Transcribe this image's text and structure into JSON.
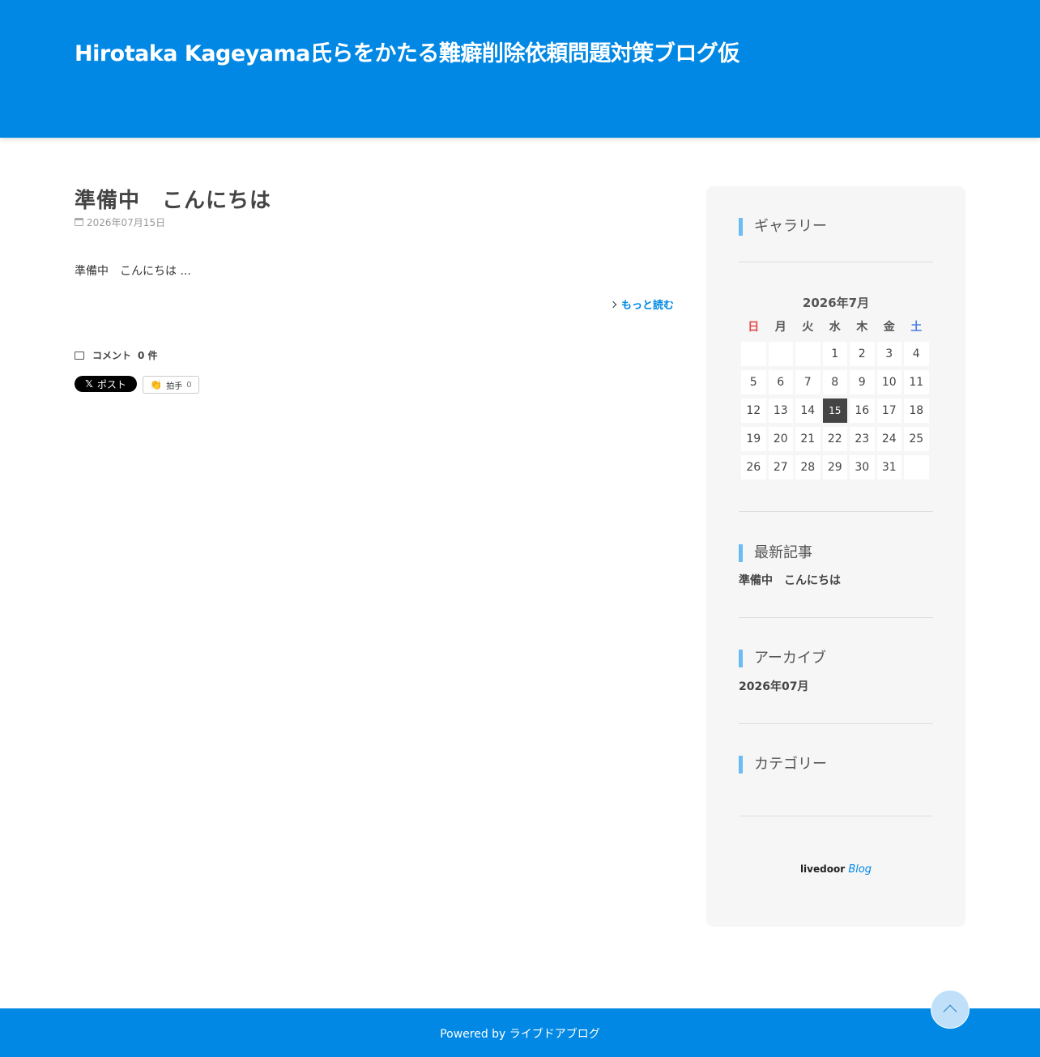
{
  "header": {
    "site_title": "Hirotaka Kageyama氏らをかたる難癖削除依頼問題対策ブログ仮"
  },
  "article": {
    "title": "準備中　こんにちは",
    "date": "2026年07月15日",
    "excerpt": "準備中　こんにちは ...",
    "read_more": "もっと読む",
    "comments_label": "コメント",
    "comments_count": "0 件",
    "x_post_label": "ポスト",
    "clap_label": "拍手",
    "clap_count": "0"
  },
  "sidebar": {
    "gallery_title": "ギャラリー",
    "calendar": {
      "caption": "2026年7月",
      "weekdays": [
        "日",
        "月",
        "火",
        "水",
        "木",
        "金",
        "土"
      ],
      "weeks": [
        [
          "",
          "",
          "",
          "1",
          "2",
          "3",
          "4"
        ],
        [
          "5",
          "6",
          "7",
          "8",
          "9",
          "10",
          "11"
        ],
        [
          "12",
          "13",
          "14",
          "15",
          "16",
          "17",
          "18"
        ],
        [
          "19",
          "20",
          "21",
          "22",
          "23",
          "24",
          "25"
        ],
        [
          "26",
          "27",
          "28",
          "29",
          "30",
          "31",
          ""
        ]
      ],
      "today": "15"
    },
    "recent_title": "最新記事",
    "recent_items": [
      "準備中　こんにちは"
    ],
    "archive_title": "アーカイブ",
    "archive_items": [
      "2026年07月"
    ],
    "category_title": "カテゴリー",
    "logo_text": "livedoor",
    "logo_blog": "Blog"
  },
  "footer": {
    "text": "Powered by ライブドアブログ"
  },
  "colors": {
    "brand": "#0088e4",
    "widget_accent": "#6cbcf4",
    "today_bg": "#444444"
  }
}
